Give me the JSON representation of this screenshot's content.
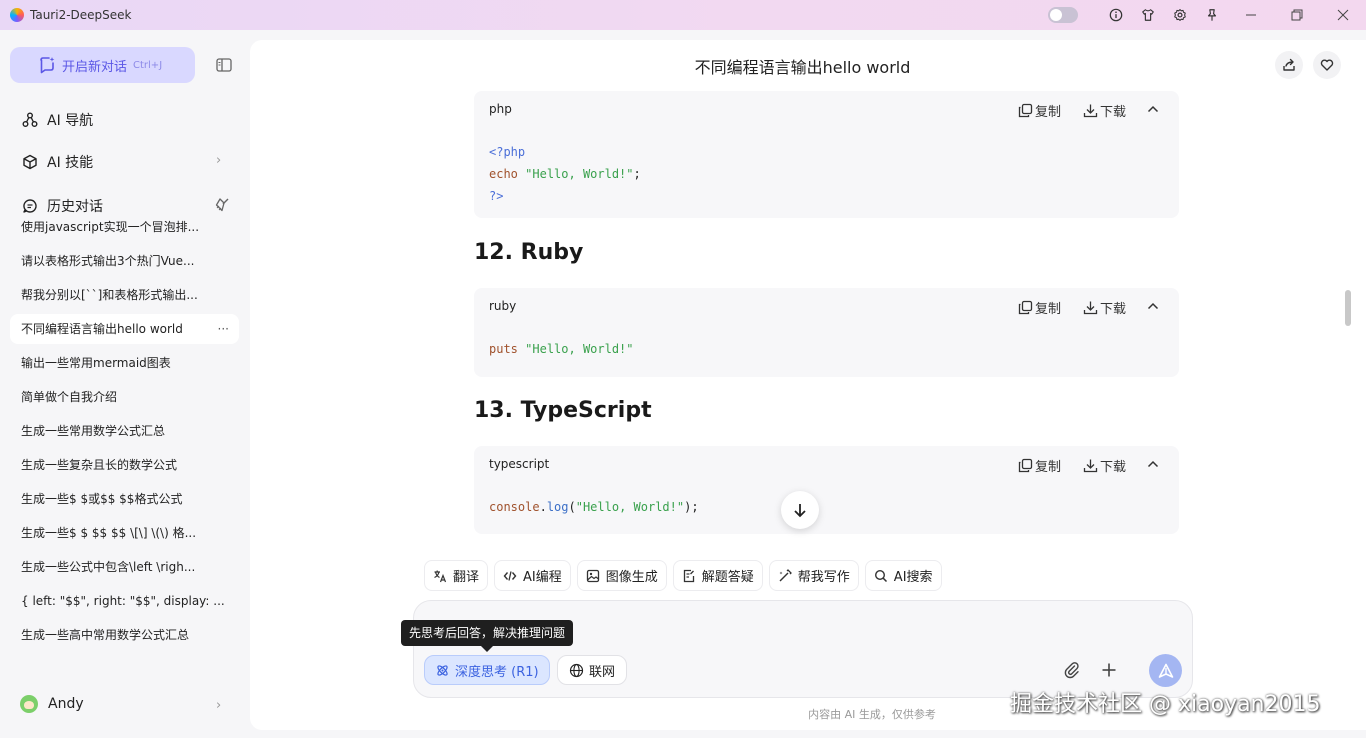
{
  "window": {
    "title": "Tauri2-DeepSeek",
    "gradient": [
      "#e9d8f6",
      "#f3d8ef"
    ]
  },
  "sidebar": {
    "new_chat_label": "开启新对话",
    "new_chat_shortcut": "Ctrl+J",
    "nav": [
      {
        "label": "AI 导航",
        "icon": "grid-nodes-icon"
      },
      {
        "label": "AI 技能",
        "icon": "cube-icon"
      }
    ],
    "history_label": "历史对话",
    "history": [
      "使用javascript实现一个冒泡排...",
      "请以表格形式输出3个热门Vue...",
      "帮我分别以[``]和表格形式输出...",
      "不同编程语言输出hello world",
      "输出一些常用mermaid图表",
      "简单做个自我介绍",
      "生成一些常用数学公式汇总",
      "生成一些复杂且长的数学公式",
      "生成一些$ $或$$ $$格式公式",
      "生成一些$ $ $$ $$ \\[\\] \\(\\) 格...",
      "生成一些公式中包含\\left \\righ...",
      "{ left: \"$$\", right: \"$$\", display: ...",
      "生成一些高中常用数学公式汇总"
    ],
    "active_history_index": 3,
    "more_label": "···",
    "user_name": "Andy"
  },
  "main": {
    "chat_title": "不同编程语言输出hello world",
    "copy_label": "复制",
    "download_label": "下载",
    "blocks": [
      {
        "lang": "php"
      },
      {
        "lang": "ruby"
      },
      {
        "lang": "typescript"
      }
    ],
    "headings": [
      "12. Ruby",
      "13. TypeScript"
    ],
    "code": {
      "php_open": "<?php",
      "php_echo": "echo",
      "php_str": "\"Hello, World!\"",
      "php_semi": ";",
      "php_close": "?>",
      "ruby_puts": "puts",
      "ruby_str": "\"Hello, World!\"",
      "ts_console": "console",
      "ts_dot": ".",
      "ts_log": "log",
      "ts_open": "(",
      "ts_str": "\"Hello, World!\"",
      "ts_close": ");"
    },
    "chips": [
      "翻译",
      "AI编程",
      "图像生成",
      "解题答疑",
      "帮我写作",
      "AI搜索"
    ],
    "tooltip": "先思考后回答，解决推理问题",
    "deep_think_label": "深度思考 (R1)",
    "network_label": "联网",
    "footer_note": "内容由 AI 生成，仅供参考",
    "accent": "#5b57e6",
    "send_color": "#a4b6f2"
  },
  "watermark": "掘金技术社区 @ xiaoyan2015"
}
